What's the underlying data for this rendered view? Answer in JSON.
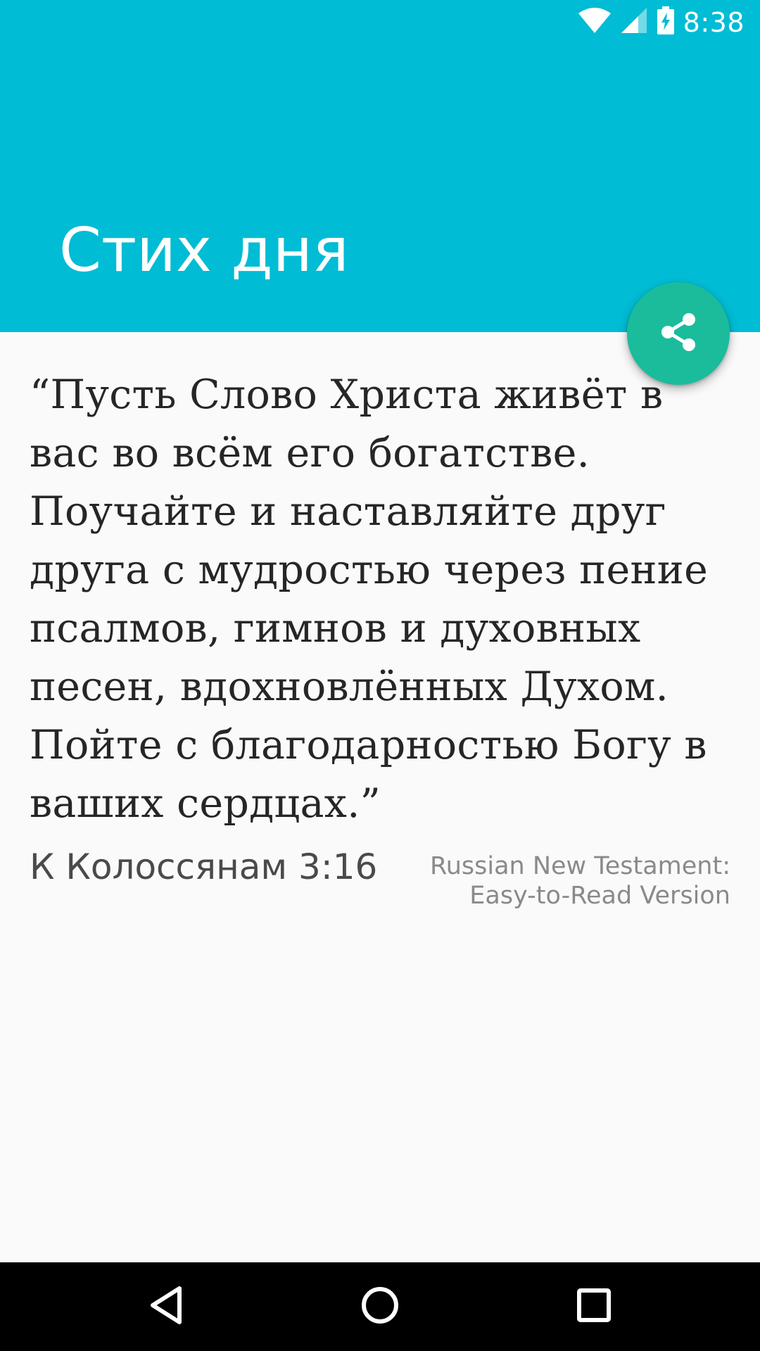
{
  "status_bar": {
    "time": "8:38",
    "icons": [
      "wifi-icon",
      "cellular-signal-icon",
      "battery-charging-icon"
    ]
  },
  "header": {
    "title": "Стих дня",
    "background_color": "#00bcd4"
  },
  "fab": {
    "icon": "share-icon",
    "color": "#1abc9c"
  },
  "verse": {
    "text": "“Пусть Слово Христа живёт в вас во всём его богатстве. Поучайте и наставляйте друг друга с мудростью через пение псалмов, гимнов и духовных песен, вдохновлённых Духом. Пойте с благодарностью Богу в ваших сердцах.”",
    "reference": "К Колоссянам 3:16",
    "translation": "Russian New Testament: Easy-to-Read Version"
  },
  "nav_bar": {
    "icons": [
      "back-icon",
      "home-icon",
      "recents-icon"
    ]
  }
}
